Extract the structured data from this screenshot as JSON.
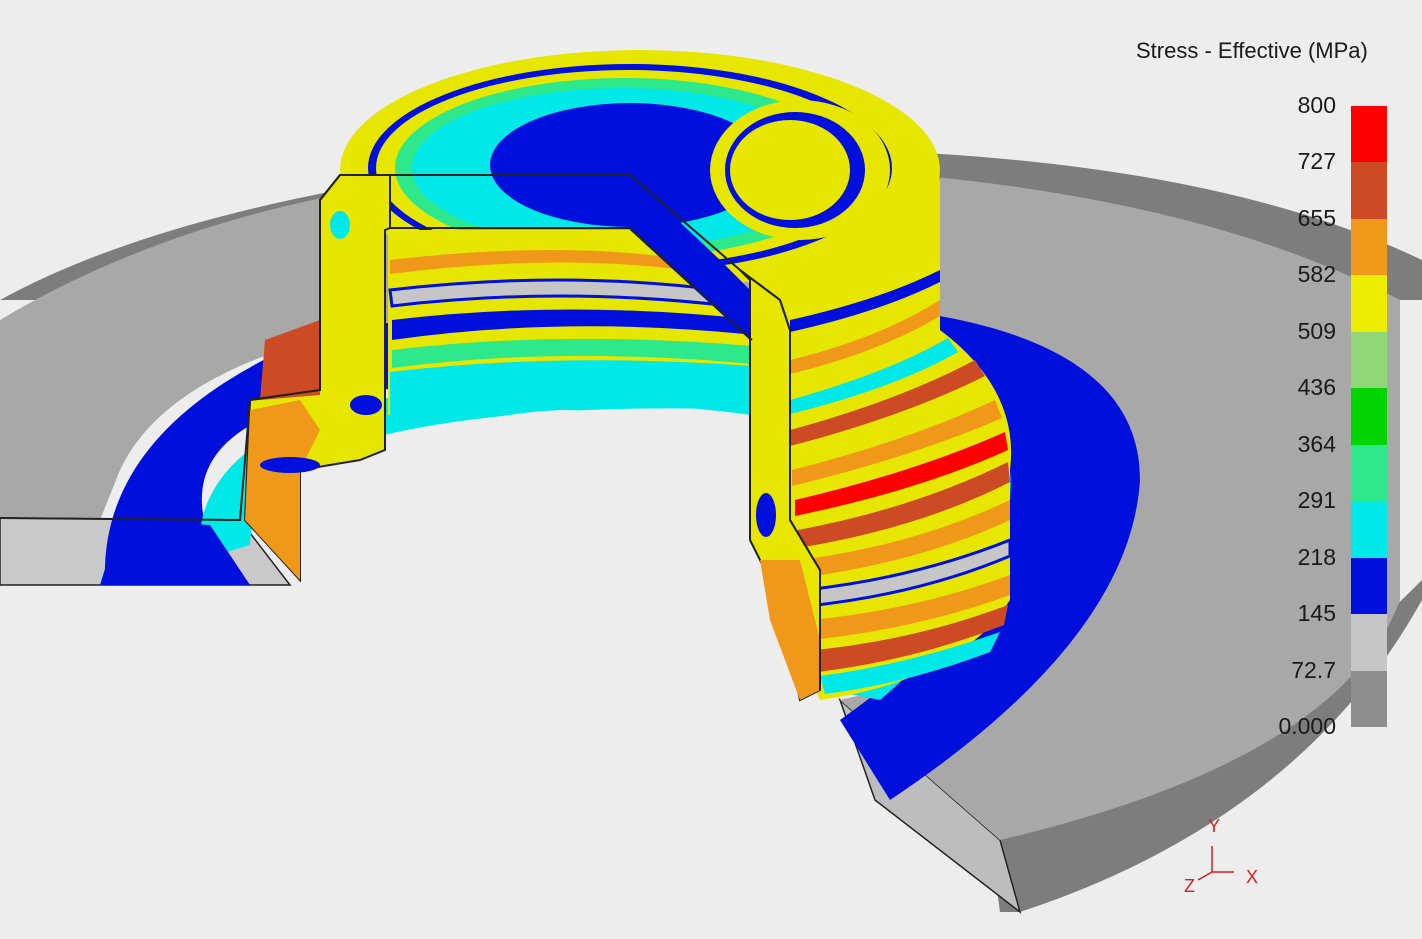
{
  "legend": {
    "title": "Stress - Effective (MPa)",
    "ticks": [
      "800",
      "727",
      "655",
      "582",
      "509",
      "436",
      "364",
      "291",
      "218",
      "145",
      "72.7",
      "0.000"
    ],
    "band_colors": [
      "#ff0000",
      "#cc4b25",
      "#f0981a",
      "#eded00",
      "#90d878",
      "#00d400",
      "#2ee88c",
      "#00e8e8",
      "#0010dc",
      "#c6c6c6",
      "#8e8e8e"
    ]
  },
  "axes": {
    "x": "X",
    "y": "Y",
    "z": "Z"
  },
  "colors": {
    "background": "#ededed",
    "unstressed_gray": "#a8a8a8",
    "dark_gray": "#7d7d7d",
    "blue": "#0010dc",
    "cyan": "#00e8e8",
    "green": "#2ee88c",
    "yellow": "#e6e600",
    "orange": "#f0981a",
    "brown": "#cc4b25",
    "red": "#ff0000",
    "axis_red": "#d42020"
  }
}
